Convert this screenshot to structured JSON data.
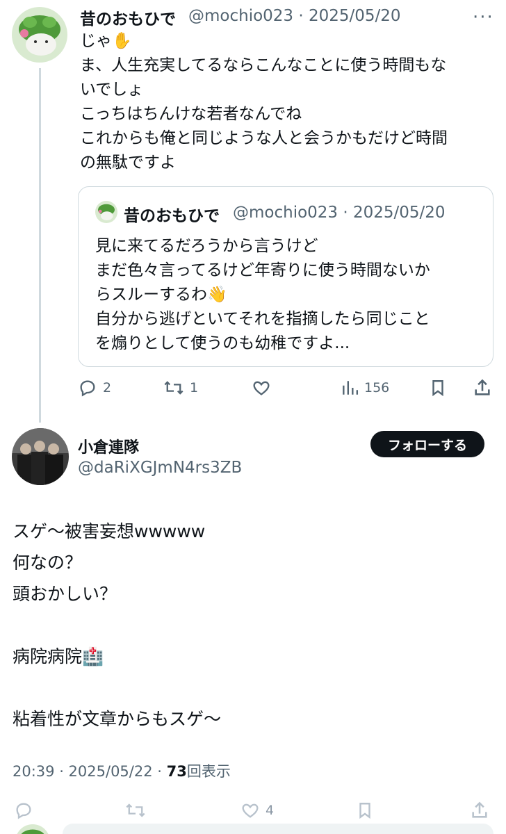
{
  "tweet1": {
    "name": "昔のおもひで",
    "handle": "@mochio023",
    "date": "2025/05/20",
    "meta": "@mochio023 · 2025/05/20",
    "text": "じゃ✋\nま、人生充実してるならこんなことに使う時間もな\nいでしょ\nこっちはちんけな若者なんでね\nこれからも俺と同じような人と会うかもだけど時間\nの無駄ですよ",
    "more_label": "···"
  },
  "quote": {
    "name": "昔のおもひで",
    "meta": "@mochio023 · 2025/05/20",
    "text": "見に来てるだろうから言うけど\nまだ色々言ってるけど年寄りに使う時間ないか\nらスルーするわ👋\n自分から逃げといてそれを指摘したら同じこと\nを煽りとして使うのも幼稚ですよ..."
  },
  "actions": {
    "reply_count": "2",
    "repost_count": "1",
    "like_count": "",
    "views_count": "156"
  },
  "tweet2": {
    "name": "小倉連隊",
    "handle": "@daRiXGJmN4rs3ZB",
    "follow_label": "フォローする",
    "text": "スゲ〜被害妄想wwwww\n何なの？\n頭おかしい？\n\n病院病院🏥\n\n粘着性が文章からもスゲ〜",
    "time": "20:39 · 2025/05/22 · ",
    "views": "73",
    "views_label": "回表示"
  },
  "bottom_actions": {
    "like_count": "4"
  },
  "colors": {
    "text": "#0f1419",
    "secondary": "#536471",
    "border": "#cfd9de",
    "follow_bg": "#0f1419"
  },
  "icons": [
    "reply-icon",
    "repost-icon",
    "like-icon",
    "views-icon",
    "bookmark-icon",
    "share-icon"
  ]
}
